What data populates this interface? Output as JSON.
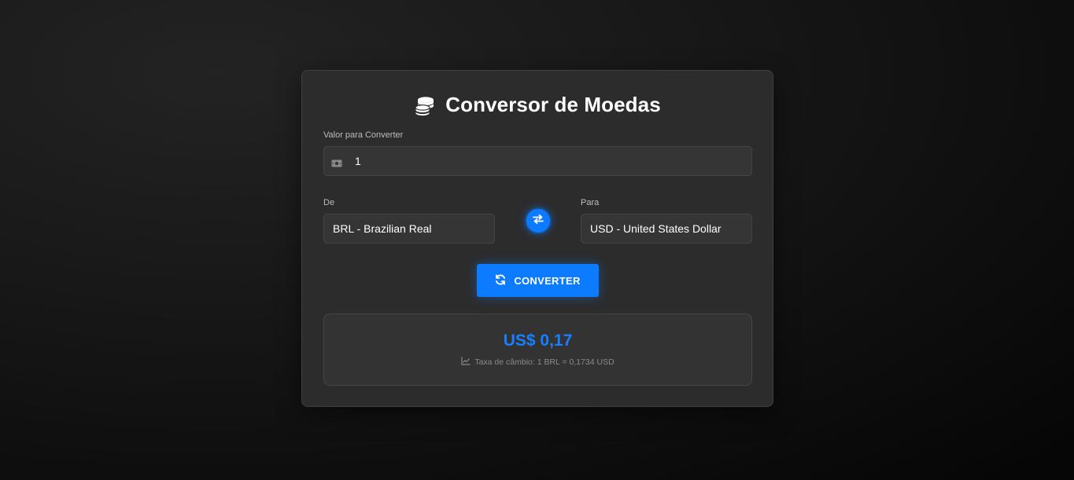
{
  "app": {
    "title": "Conversor de Moedas",
    "title_icon": "coins-icon"
  },
  "amount": {
    "label": "Valor para Converter",
    "icon": "money-bill-icon",
    "value": "1"
  },
  "from": {
    "label": "De",
    "selected": "BRL - Brazilian Real"
  },
  "to": {
    "label": "Para",
    "selected": "USD - United States Dollar"
  },
  "swap": {
    "icon": "exchange-arrows-icon"
  },
  "convert_button": {
    "label": "CONVERTER",
    "icon": "sync-icon"
  },
  "result": {
    "value": "US$ 0,17",
    "rate_icon": "chart-line-icon",
    "rate_text": "Taxa de câmbio: 1 BRL = 0,1734 USD"
  },
  "colors": {
    "accent": "#0d7bff",
    "card": "#2c2c2c",
    "field": "#353535"
  }
}
